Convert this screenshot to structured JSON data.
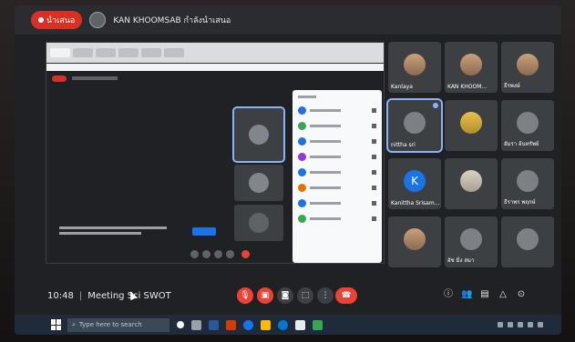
{
  "top_bar": {
    "present_label": "นำเสนอ",
    "presenter_name": "KAN KHOOMSAB กำลังนำเสนอ"
  },
  "participants": [
    {
      "name": "Kanlaya",
      "face": "photo"
    },
    {
      "name": "KAN KHOOM...",
      "face": "photo"
    },
    {
      "name": "ธีรพงษ์",
      "face": "photo"
    },
    {
      "name": "nittha sri",
      "face": "grey",
      "active": true
    },
    {
      "name": "",
      "face": "photo"
    },
    {
      "name": "อัมรา อ้นทรัพย์",
      "face": "grey"
    },
    {
      "name": "Kanittha Srisam...",
      "face": "letter",
      "letter": "K"
    },
    {
      "name": "",
      "face": "photo"
    },
    {
      "name": "ธีราพร พฤกษ์",
      "face": "grey"
    },
    {
      "name": "",
      "face": "photo"
    },
    {
      "name": "อัช มิ่ง สมา",
      "face": "grey"
    },
    {
      "name": "",
      "face": "grey"
    }
  ],
  "meeting": {
    "time": "10:48",
    "separator": "|",
    "title": "Meeting Sci SWOT"
  },
  "taskbar": {
    "search_placeholder": "Type here to search"
  },
  "icons": {
    "mic": "mic-icon",
    "camera": "camera-icon",
    "captions": "captions-icon",
    "present": "present-icon",
    "more": "more-icon",
    "hangup": "hangup-icon"
  }
}
